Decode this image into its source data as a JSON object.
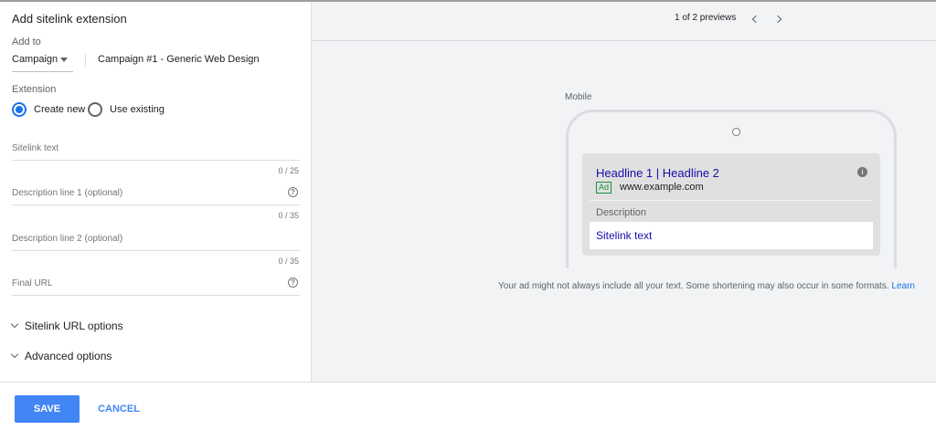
{
  "panel": {
    "title": "Add sitelink extension",
    "add_to_label": "Add to",
    "level_select": "Campaign",
    "campaign_name": "Campaign #1 - Generic Web Design",
    "extension_label": "Extension",
    "radio_create": "Create new",
    "radio_existing": "Use existing",
    "selected_radio": "Create new"
  },
  "fields": {
    "sitelink_text": {
      "placeholder": "Sitelink text",
      "counter": "0 / 25"
    },
    "desc1": {
      "placeholder": "Description line 1 (optional)",
      "counter": "0 / 35"
    },
    "desc2": {
      "placeholder": "Description line 2 (optional)",
      "counter": "0 / 35"
    },
    "final_url": {
      "placeholder": "Final URL"
    }
  },
  "expanders": {
    "url_options": "Sitelink URL options",
    "advanced": "Advanced options"
  },
  "preview": {
    "count": "1 of 2 previews",
    "device_label": "Mobile",
    "headline": "Headline 1 | Headline 2",
    "ad_badge": "Ad",
    "display_url": "www.example.com",
    "description": "Description",
    "sitelink": "Sitelink text",
    "disclaimer": "Your ad might not always include all your text. Some shortening may also occur in some formats.",
    "learn_more": "Learn"
  },
  "footer": {
    "save": "SAVE",
    "cancel": "CANCEL"
  },
  "colors": {
    "accent": "#4285f4",
    "radio_active": "#1a73e8",
    "link": "#1a0dab",
    "ad_badge": "#1e8e3e"
  }
}
